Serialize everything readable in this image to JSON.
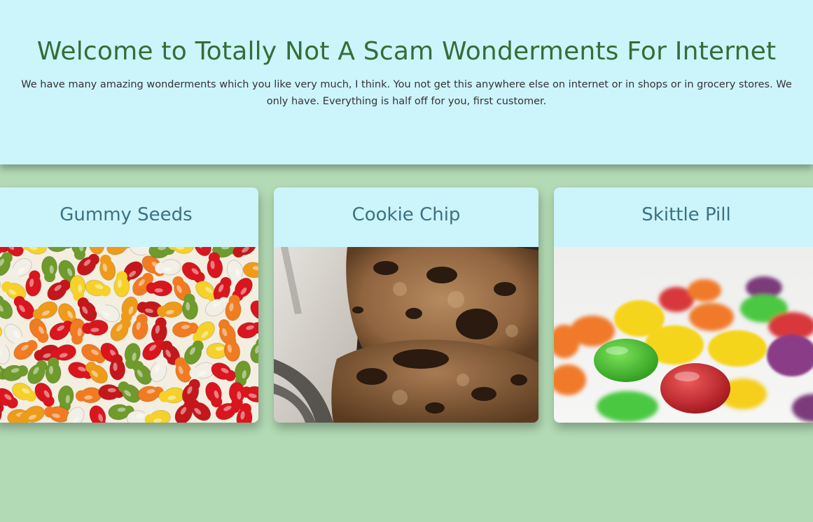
{
  "hero": {
    "title": "Welcome to Totally Not A Scam Wonderments For Internet",
    "description": "We have many amazing wonderments which you like very much, I think. You not get this anywhere else on internet or in shops or in grocery stores. We only have. Everything is half off for you, first customer."
  },
  "cards": [
    {
      "title": "Gummy Seeds",
      "image": "gummy-bears-photo"
    },
    {
      "title": "Cookie Chip",
      "image": "chocolate-chip-cookies-photo"
    },
    {
      "title": "Skittle Pill",
      "image": "skittles-candy-photo"
    }
  ],
  "colors": {
    "page_background": "#b2dab4",
    "header_background": "#ccf4fb",
    "title_color": "#336e37",
    "card_title_color": "#3b7281"
  }
}
